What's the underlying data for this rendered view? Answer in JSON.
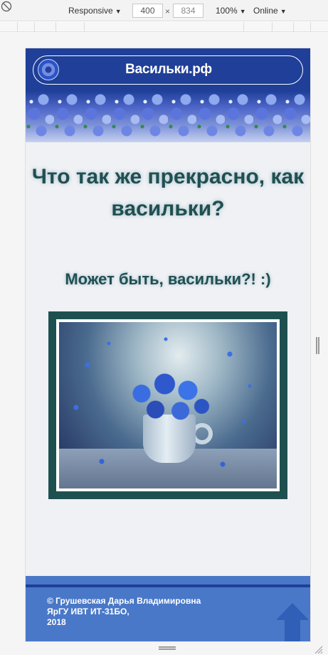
{
  "devtools": {
    "device": "Responsive",
    "width": "400",
    "height": "834",
    "zoom": "100%",
    "network": "Online"
  },
  "site": {
    "title": "Васильки.рф",
    "heading": "Что так же прекрасно, как васильки?",
    "subheading": "Может быть, васильки?! :)",
    "footer": {
      "line1": "© Грушевская Дарья Владимировна",
      "line2": "ЯрГУ ИВТ ИТ-31БО,",
      "line3": "2018"
    }
  },
  "colors": {
    "header": "#1f3f98",
    "heading_text": "#1f5050",
    "frame": "#1f5050",
    "footer": "#4a78c8",
    "page_bg": "#eff1f4"
  },
  "icons": {
    "logo": "cornflower-logo-icon",
    "scroll_top": "arrow-up-icon",
    "rotate": "rotate-disabled-icon"
  }
}
